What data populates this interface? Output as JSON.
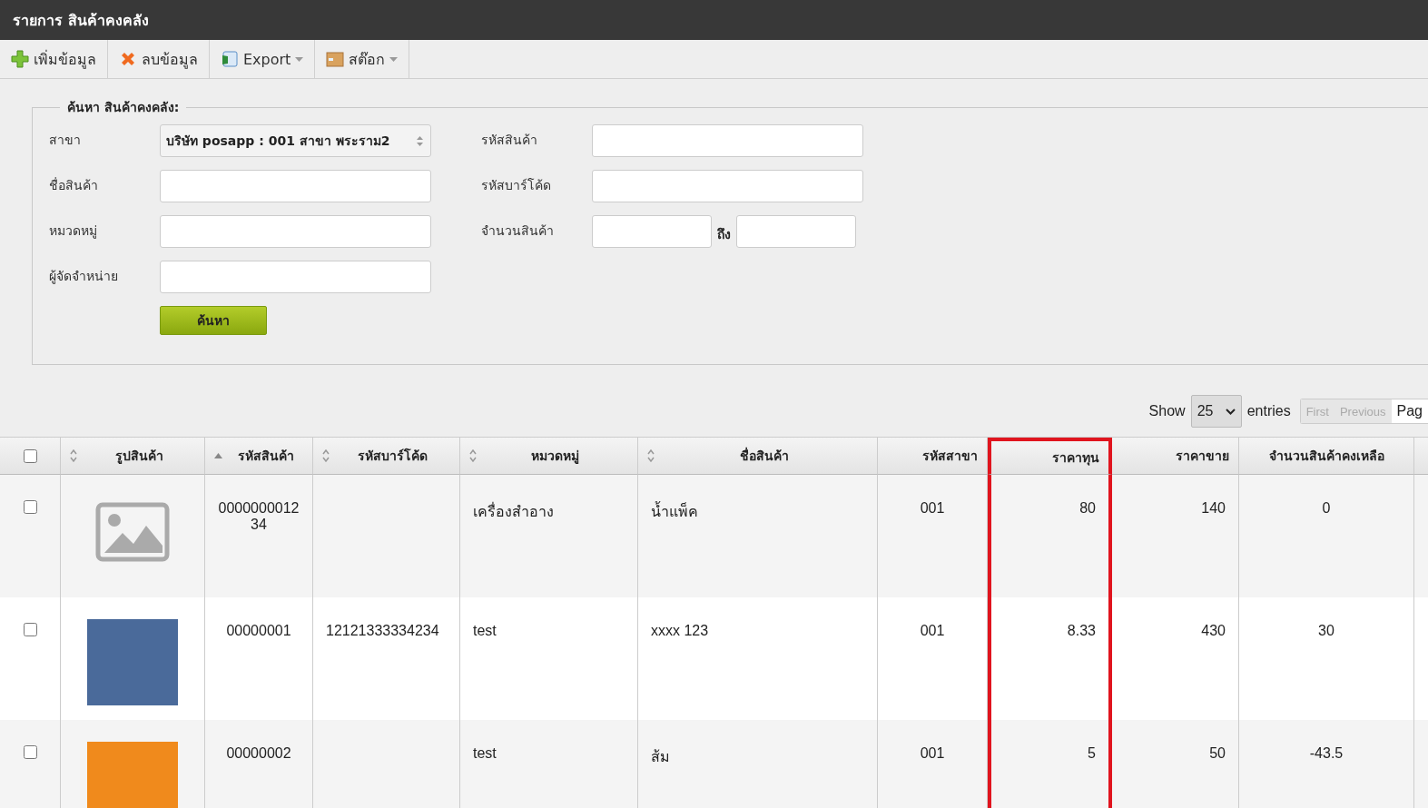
{
  "window": {
    "title": "รายการ สินค้าคงคลัง"
  },
  "toolbar": [
    {
      "label": "เพิ่มข้อมูล",
      "kind": "add",
      "dropdown": false
    },
    {
      "label": "ลบข้อมูล",
      "kind": "delete",
      "dropdown": false
    },
    {
      "label": "Export",
      "kind": "excel",
      "dropdown": true
    },
    {
      "label": "สต๊อก",
      "kind": "box",
      "dropdown": true
    }
  ],
  "search": {
    "legend": "ค้นหา สินค้าคงคลัง:",
    "left_fields": [
      {
        "label": "สาขา",
        "kind": "select",
        "value": "บริษัท posapp : 001 สาขา พระราม2"
      },
      {
        "label": "ชื่อสินค้า",
        "kind": "text"
      },
      {
        "label": "หมวดหมู่",
        "kind": "text"
      },
      {
        "label": "ผู้จัดจำหน่าย",
        "kind": "text"
      }
    ],
    "right_fields": [
      {
        "label": "รหัสสินค้า",
        "kind": "text"
      },
      {
        "label": "รหัสบาร์โค้ด",
        "kind": "text"
      },
      {
        "label": "จำนวนสินค้า",
        "kind": "range",
        "separator": "ถึง"
      }
    ],
    "button": "ค้นหา"
  },
  "table_controls": {
    "show_label": "Show",
    "page_size": "25",
    "entries_label": "entries",
    "pager": [
      {
        "label": "First",
        "disabled": true
      },
      {
        "label": "Previous",
        "disabled": true
      },
      {
        "label": "Pag",
        "disabled": false
      }
    ]
  },
  "table": {
    "select_all_checked": false,
    "columns": [
      {
        "label": "รูปสินค้า",
        "kind": "sortable",
        "highlighted": false
      },
      {
        "label": "รหัสสินค้า",
        "kind": "sorted",
        "highlighted": false
      },
      {
        "label": "รหัสบาร์โค้ด",
        "kind": "sortable",
        "highlighted": false
      },
      {
        "label": "หมวดหมู่",
        "kind": "sortable",
        "highlighted": false
      },
      {
        "label": "ชื่อสินค้า",
        "kind": "sortable",
        "highlighted": false
      },
      {
        "label": "รหัสสาขา",
        "kind": "plain",
        "highlighted": false
      },
      {
        "label": "ราคาทุน",
        "kind": "plain",
        "highlighted": true
      },
      {
        "label": "ราคาขาย",
        "kind": "plain",
        "highlighted": false
      },
      {
        "label": "จำนวนสินค้าคงเหลือ",
        "kind": "plain",
        "highlighted": false
      }
    ],
    "rows": [
      {
        "checked": false,
        "kind": "placeholder",
        "cells": [
          "",
          "000000001234",
          "",
          "เครื่องสำอาง",
          "น้ำแพ็ค",
          "001",
          "80",
          "140",
          "0"
        ]
      },
      {
        "checked": false,
        "kind": "photo",
        "cells": [
          "",
          "00000001",
          "12121333334234",
          "test",
          "xxxx 123",
          "001",
          "8.33",
          "430",
          "30"
        ]
      },
      {
        "checked": false,
        "kind": "photo",
        "cells": [
          "",
          "00000002",
          "",
          "test",
          "ส้ม",
          "001",
          "5",
          "50",
          "-43.5"
        ]
      }
    ]
  }
}
